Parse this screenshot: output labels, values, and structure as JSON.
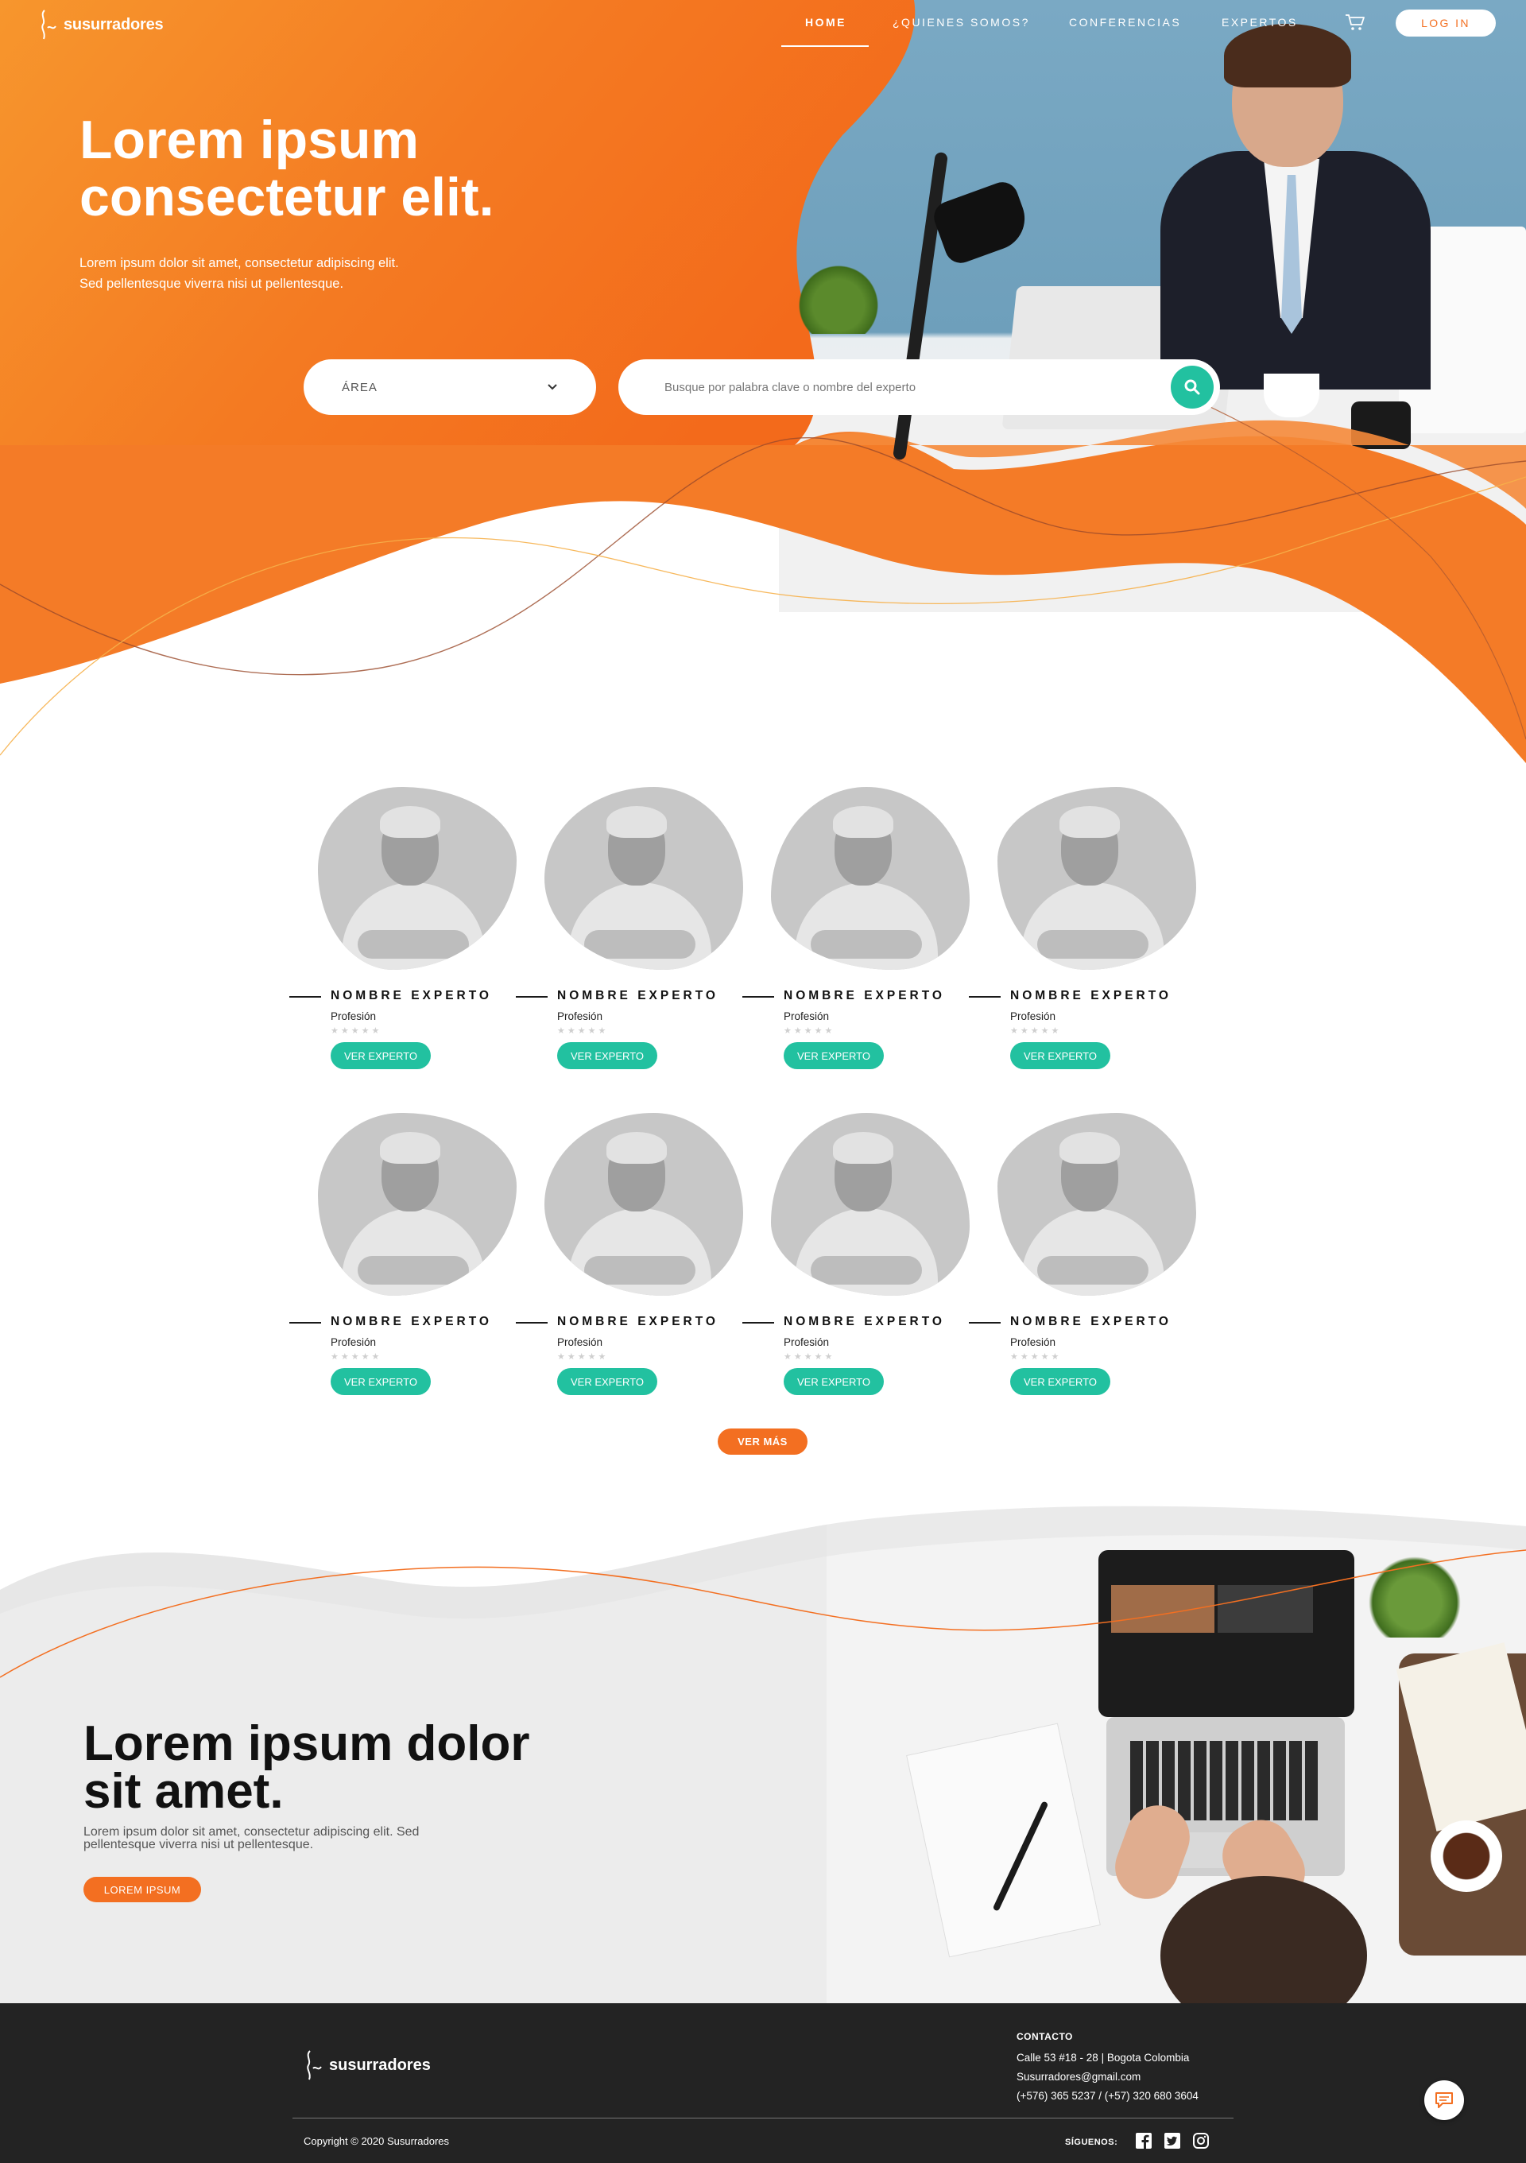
{
  "brand": {
    "name": "susurradores",
    "accent": "#f36f21",
    "teal": "#22c1a0",
    "dark": "#232323"
  },
  "nav": {
    "items": [
      {
        "label": "HOME",
        "active": true
      },
      {
        "label": "¿QUIENES SOMOS?",
        "active": false
      },
      {
        "label": "CONFERENCIAS",
        "active": false
      },
      {
        "label": "EXPERTOS",
        "active": false
      }
    ],
    "cart_icon": "cart-icon",
    "login_label": "LOG IN"
  },
  "hero": {
    "title_line1": "Lorem ipsum",
    "title_line2": "consectetur elit.",
    "subtitle_line1": "Lorem ipsum dolor sit amet, consectetur adipiscing elit.",
    "subtitle_line2": "Sed pellentesque viverra nisi ut pellentesque.",
    "area_select_value": "ÁREA",
    "search_placeholder": "Busque por palabra clave o nombre del experto",
    "search_icon": "search-icon"
  },
  "experts": {
    "cards": [
      {
        "name": "NOMBRE EXPERTO",
        "profession": "Profesión",
        "rating": 0,
        "button": "VER EXPERTO"
      },
      {
        "name": "NOMBRE EXPERTO",
        "profession": "Profesión",
        "rating": 0,
        "button": "VER EXPERTO"
      },
      {
        "name": "NOMBRE EXPERTO",
        "profession": "Profesión",
        "rating": 0,
        "button": "VER EXPERTO"
      },
      {
        "name": "NOMBRE EXPERTO",
        "profession": "Profesión",
        "rating": 0,
        "button": "VER EXPERTO"
      },
      {
        "name": "NOMBRE EXPERTO",
        "profession": "Profesión",
        "rating": 0,
        "button": "VER EXPERTO"
      },
      {
        "name": "NOMBRE EXPERTO",
        "profession": "Profesión",
        "rating": 0,
        "button": "VER EXPERTO"
      },
      {
        "name": "NOMBRE EXPERTO",
        "profession": "Profesión",
        "rating": 0,
        "button": "VER EXPERTO"
      },
      {
        "name": "NOMBRE EXPERTO",
        "profession": "Profesión",
        "rating": 0,
        "button": "VER EXPERTO"
      }
    ],
    "stars": "★★★★★",
    "more_button": "VER MÁS"
  },
  "promo": {
    "title_line1": "Lorem ipsum dolor",
    "title_line2": "sit amet.",
    "text_line1": "Lorem ipsum dolor sit amet, consectetur adipiscing elit. Sed",
    "text_line2": "pellentesque viverra nisi ut pellentesque.",
    "button": "LOREM IPSUM"
  },
  "footer": {
    "logo_text": "susurradores",
    "contact_title": "CONTACTO",
    "address": "Calle 53 #18 - 28 | Bogota Colombia",
    "email": "Susurradores@gmail.com",
    "phones": "(+576) 365 5237 / (+57) 320 680 3604",
    "copyright": "Copyright © 2020 Susurradores",
    "follow_label": "SÍGUENOS:",
    "social_icons": [
      "facebook-icon",
      "twitter-icon",
      "instagram-icon"
    ],
    "chat_icon": "chat-icon"
  }
}
